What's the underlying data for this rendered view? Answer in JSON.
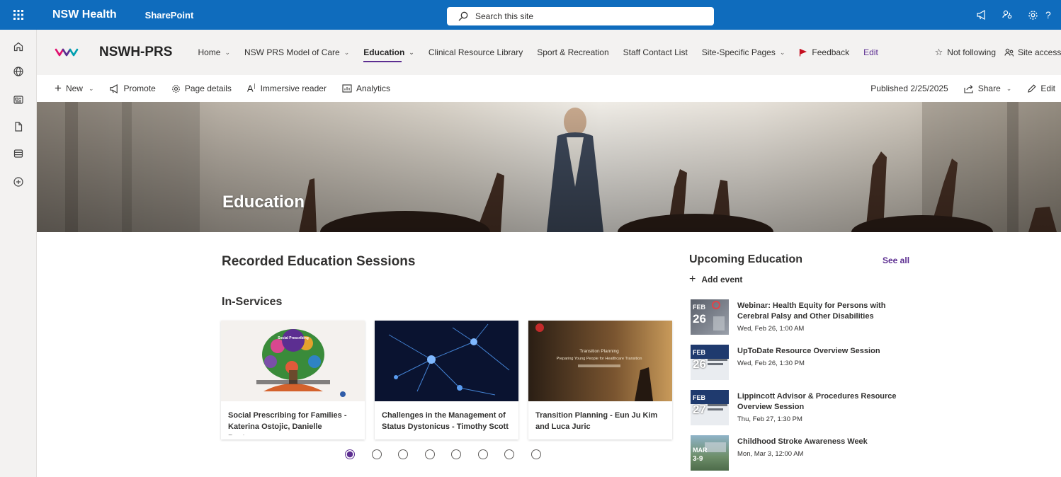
{
  "suite": {
    "brand": "NSW Health",
    "app": "SharePoint",
    "search_placeholder": "Search this site",
    "help_glyph": "?"
  },
  "rail": {
    "icons": [
      "home-icon",
      "globe-icon",
      "news-icon",
      "file-icon",
      "list-icon",
      "add-circle-icon"
    ]
  },
  "site": {
    "title": "NSWH-PRS",
    "nav": [
      {
        "label": "Home",
        "dropdown": true
      },
      {
        "label": "NSW PRS Model of Care",
        "dropdown": true
      },
      {
        "label": "Education",
        "dropdown": true,
        "active": true
      },
      {
        "label": "Clinical Resource Library",
        "dropdown": false
      },
      {
        "label": "Sport & Recreation",
        "dropdown": false
      },
      {
        "label": "Staff Contact List",
        "dropdown": false
      },
      {
        "label": "Site-Specific Pages",
        "dropdown": true
      }
    ],
    "feedback": "Feedback",
    "edit": "Edit",
    "not_following": "Not following",
    "site_access": "Site access"
  },
  "commands": {
    "new": "New",
    "promote": "Promote",
    "page_details": "Page details",
    "immersive_reader": "Immersive reader",
    "analytics": "Analytics",
    "published": "Published 2/25/2025",
    "share": "Share",
    "edit": "Edit"
  },
  "hero": {
    "title": "Education"
  },
  "recorded": {
    "heading": "Recorded Education Sessions",
    "subheading": "In-Services",
    "cards": [
      {
        "title": "Social Prescribing for Families - Katerina Ostojic, Danielle Beston,...",
        "thumb_text": "Social Prescribing"
      },
      {
        "title": "Challenges in the Management of Status Dystonicus - Timothy Scott"
      },
      {
        "title": "Transition Planning - Eun Ju Kim and Luca Juric",
        "thumb_text": "Transition Planning",
        "thumb_subtext": "Preparing Young People for Healthcare Transition"
      }
    ],
    "pager_pages": 8,
    "pager_active": 1
  },
  "upcoming": {
    "heading": "Upcoming Education",
    "see_all": "See all",
    "add_event": "Add event",
    "events": [
      {
        "month": "FEB",
        "day": "26",
        "title": "Webinar: Health Equity for Persons with Cerebral Palsy and Other Disabilities",
        "when": "Wed, Feb 26, 1:00 AM"
      },
      {
        "month": "FEB",
        "day": "26",
        "title": "UpToDate Resource Overview Session",
        "when": "Wed, Feb 26, 1:30 PM"
      },
      {
        "month": "FEB",
        "day": "27",
        "title": "Lippincott Advisor & Procedures Resource Overview Session",
        "when": "Thu, Feb 27, 1:30 PM"
      },
      {
        "month": "MAR",
        "day": "3-9",
        "title": "Childhood Stroke Awareness Week",
        "when": "Mon, Mar 3, 12:00 AM"
      }
    ]
  },
  "colors": {
    "suite_bar": "#0f6cbd",
    "accent": "#5c2e91",
    "feedback_flag": "#c50f1f"
  }
}
